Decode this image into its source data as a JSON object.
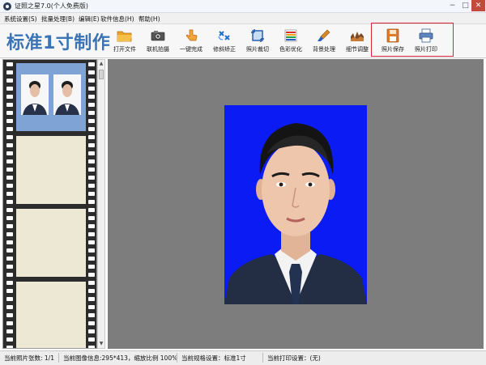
{
  "window": {
    "title": "证照之星7.0(个人免费版)",
    "minimize": "−",
    "maximize": "□",
    "close": "✕"
  },
  "menu": [
    "系统设置(S)",
    "批量处理(B)",
    "编辑(E)",
    "软件信息(H)",
    "帮助(H)"
  ],
  "toolbar": {
    "brand": "标准1寸制作",
    "tools": [
      {
        "label": "打开文件",
        "icon": "folder-icon"
      },
      {
        "label": "联机拍摄",
        "icon": "camera-icon"
      },
      {
        "label": "一键完成",
        "icon": "hand-click-icon"
      },
      {
        "label": "修斜矫正",
        "icon": "rotate-icon"
      },
      {
        "label": "照片裁切",
        "icon": "crop-icon"
      },
      {
        "label": "色彩优化",
        "icon": "color-bars-icon"
      },
      {
        "label": "背景处理",
        "icon": "brush-icon"
      },
      {
        "label": "细节调整",
        "icon": "detail-chart-icon"
      },
      {
        "label": "照片保存",
        "icon": "save-disk-icon"
      },
      {
        "label": "照片打印",
        "icon": "printer-icon"
      }
    ],
    "highlight_color": "#e0213a"
  },
  "colors": {
    "brand": "#3a74b6",
    "photo_background": "#0b1bf3",
    "canvas": "#7d7d7d",
    "selected_frame": "#7fa3d4"
  },
  "status": {
    "photo_count": "当前照片张数: 1/1",
    "image_info": "当前图像信息:295*413，缩放比例 100%",
    "spec": "当前规格设置：标准1寸",
    "print_setting": "当前打印设置：(无)"
  }
}
